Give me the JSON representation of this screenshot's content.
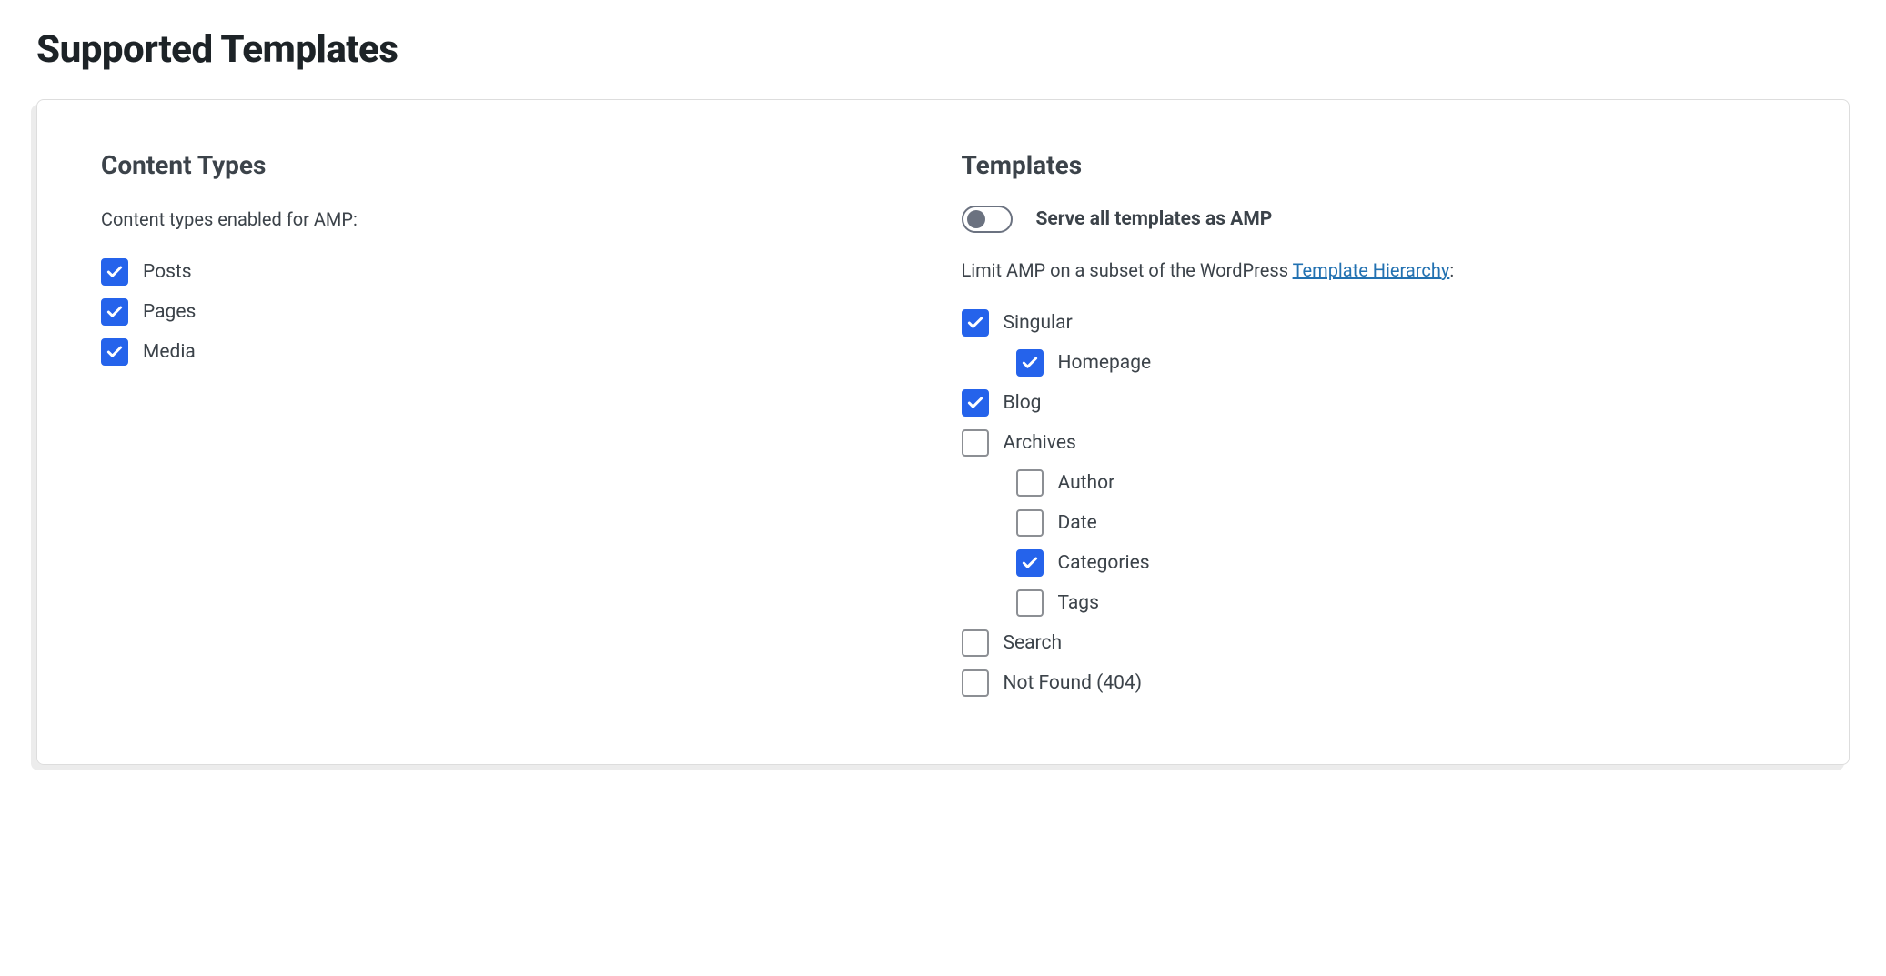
{
  "section_title": "Supported Templates",
  "content_types": {
    "title": "Content Types",
    "description": "Content types enabled for AMP:",
    "items": [
      {
        "label": "Posts",
        "checked": true
      },
      {
        "label": "Pages",
        "checked": true
      },
      {
        "label": "Media",
        "checked": true
      }
    ]
  },
  "templates": {
    "title": "Templates",
    "toggle_label": "Serve all templates as AMP",
    "toggle_on": false,
    "description_pre": "Limit AMP on a subset of the WordPress ",
    "description_link": "Template Hierarchy",
    "description_post": ":",
    "items": [
      {
        "label": "Singular",
        "checked": true,
        "indent": false
      },
      {
        "label": "Homepage",
        "checked": true,
        "indent": true
      },
      {
        "label": "Blog",
        "checked": true,
        "indent": false
      },
      {
        "label": "Archives",
        "checked": false,
        "indent": false
      },
      {
        "label": "Author",
        "checked": false,
        "indent": true
      },
      {
        "label": "Date",
        "checked": false,
        "indent": true
      },
      {
        "label": "Categories",
        "checked": true,
        "indent": true
      },
      {
        "label": "Tags",
        "checked": false,
        "indent": true
      },
      {
        "label": "Search",
        "checked": false,
        "indent": false
      },
      {
        "label": "Not Found (404)",
        "checked": false,
        "indent": false
      }
    ]
  }
}
